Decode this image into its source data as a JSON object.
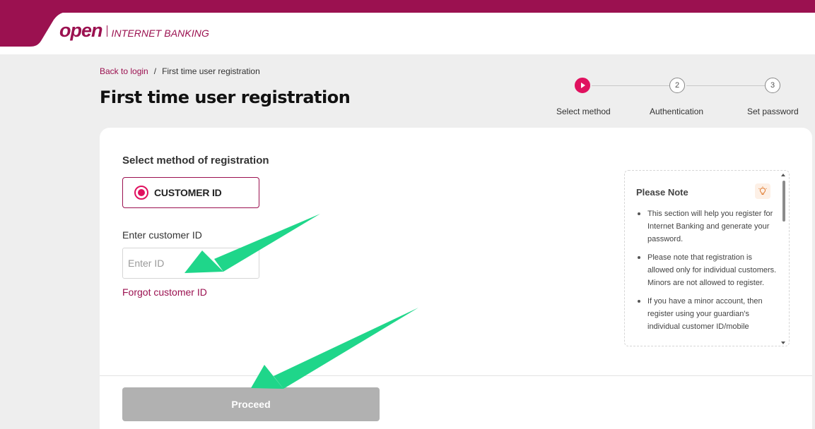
{
  "brand": {
    "logo_text": "open",
    "logo_subtitle": "INTERNET BANKING",
    "primary_color": "#9b1150",
    "accent_color": "#e0115f"
  },
  "breadcrumb": {
    "back_link": "Back to login",
    "separator": "/",
    "current": "First time user registration"
  },
  "page": {
    "title": "First time user registration"
  },
  "stepper": {
    "steps": [
      {
        "label": "Select method",
        "number": "",
        "state": "active"
      },
      {
        "label": "Authentication",
        "number": "2",
        "state": "pending"
      },
      {
        "label": "Set password",
        "number": "3",
        "state": "pending"
      }
    ]
  },
  "form": {
    "section_title": "Select method of registration",
    "option": {
      "label": "CUSTOMER ID",
      "selected": true
    },
    "id_label": "Enter customer ID",
    "id_placeholder": "Enter ID",
    "id_value": "",
    "forgot_link": "Forgot customer ID",
    "proceed_label": "Proceed",
    "proceed_enabled": false
  },
  "note": {
    "title": "Please Note",
    "icon": "lightbulb-icon",
    "items": [
      "This section will help you register for Internet Banking and generate your password.",
      "Please note that registration is allowed only for individual customers. Minors are not allowed to register.",
      "If you have a minor account, then register using your guardian's individual customer ID/mobile"
    ]
  },
  "annotation": {
    "arrow_color": "#1fd68a"
  }
}
